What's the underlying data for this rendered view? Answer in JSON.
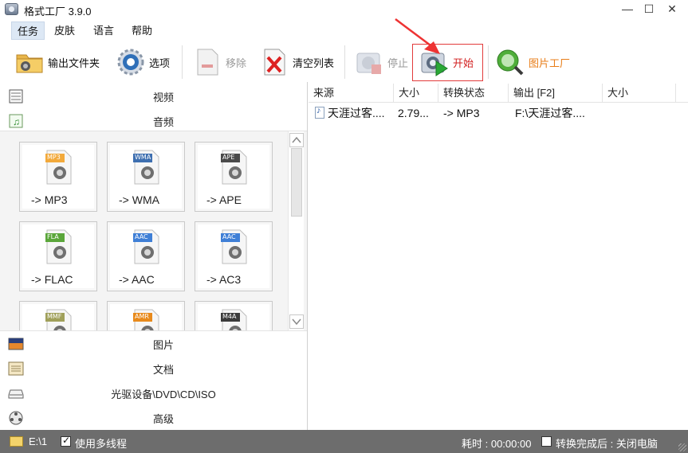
{
  "window": {
    "title": "格式工厂 3.9.0",
    "minimize": "—",
    "maximize": "☐",
    "close": "✕"
  },
  "menu": {
    "items": [
      "任务",
      "皮肤",
      "语言",
      "帮助"
    ]
  },
  "toolbar": {
    "output_folder": "输出文件夹",
    "options": "选项",
    "remove": "移除",
    "clear_list": "清空列表",
    "stop": "停止",
    "start": "开始",
    "picture_factory": "图片工厂",
    "colors": {
      "start_label": "#d21f1f",
      "picture_factory_label": "#e87d18",
      "highlight": "#e23b3b"
    }
  },
  "categories": {
    "video": "视频",
    "audio": "音频",
    "picture": "图片",
    "document": "文档",
    "optical": "光驱设备\\DVD\\CD\\ISO",
    "advanced": "高级"
  },
  "audio_formats": [
    {
      "badge": "MP3",
      "label": "-> MP3",
      "badge_color": "#f2a93b",
      "icon": "speaker-icon"
    },
    {
      "badge": "WMA",
      "label": "-> WMA",
      "badge_color": "#3e6fb0",
      "icon": "play-disc-icon"
    },
    {
      "badge": "APE",
      "label": "-> APE",
      "badge_color": "#4a4a4a",
      "icon": "headphone-disc-icon"
    },
    {
      "badge": "FLA",
      "label": "-> FLAC",
      "badge_color": "#5aa63a",
      "icon": "headphone-icon"
    },
    {
      "badge": "AAC",
      "label": "-> AAC",
      "badge_color": "#3f7fd6",
      "icon": "speaker-note-icon"
    },
    {
      "badge": "AAC",
      "label": "-> AC3",
      "badge_color": "#3f7fd6",
      "icon": "speaker-note-icon"
    },
    {
      "badge": "MMF",
      "label": "",
      "badge_color": "#a0a05a",
      "icon": "doc-icon"
    },
    {
      "badge": "AMR",
      "label": "",
      "badge_color": "#e88a1c",
      "icon": "doc-icon"
    },
    {
      "badge": "M4A",
      "label": "",
      "badge_color": "#3b3b3b",
      "icon": "doc-icon"
    }
  ],
  "table": {
    "headers": [
      "来源",
      "大小",
      "转换状态",
      "输出 [F2]",
      "大小"
    ],
    "rows": [
      {
        "source": "天涯过客....",
        "size": "2.79...",
        "status": "-> MP3",
        "output": "F:\\天涯过客....",
        "out_size": ""
      }
    ]
  },
  "status": {
    "drive": "E:\\1",
    "multithread_label": "使用多线程",
    "multithread_checked": true,
    "elapsed": "耗时 : 00:00:00",
    "after_done": "转换完成后 : 关闭电脑",
    "after_done_checked": false
  }
}
